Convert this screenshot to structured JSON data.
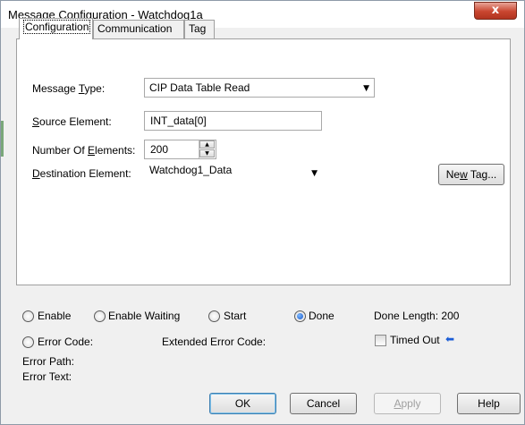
{
  "window": {
    "title": "Message Configuration - Watchdog1a",
    "close_glyph": "x"
  },
  "tabs": [
    {
      "label": "Configuration",
      "active": true
    },
    {
      "label": "Communication",
      "active": false
    },
    {
      "label": "Tag",
      "active": false
    }
  ],
  "config": {
    "message_type": {
      "label_pre": "Message ",
      "label_u": "T",
      "label_post": "ype:",
      "value": "CIP Data Table Read"
    },
    "source_element": {
      "label_u": "S",
      "label_post": "ource Element:",
      "value": "INT_data[0]"
    },
    "num_elements": {
      "label_pre": "Number Of ",
      "label_u": "E",
      "label_post": "lements:",
      "value": "200"
    },
    "destination_element": {
      "label_u": "D",
      "label_post": "estination Element:",
      "value": "Watchdog1_Data"
    },
    "new_tag": {
      "label_pre": "Ne",
      "label_u": "w",
      "label_post": " Tag..."
    }
  },
  "status": {
    "enable": "Enable",
    "enable_waiting": "Enable Waiting",
    "start": "Start",
    "done": "Done",
    "done_length": "Done Length:  200",
    "error_code": "Error Code:",
    "extended_error_code": "Extended Error Code:",
    "timed_out": "Timed Out",
    "timed_out_checked": false,
    "error_path": "Error Path:",
    "error_text": "Error Text:",
    "selected_radio": "done"
  },
  "buttons": {
    "ok": "OK",
    "cancel": "Cancel",
    "apply_u": "A",
    "apply_post": "pply",
    "help": "Help"
  },
  "colors": {
    "accent_radio": "#1657c9",
    "close_button": "#c9452f",
    "arrow_indicator": "#1a5cd6"
  }
}
